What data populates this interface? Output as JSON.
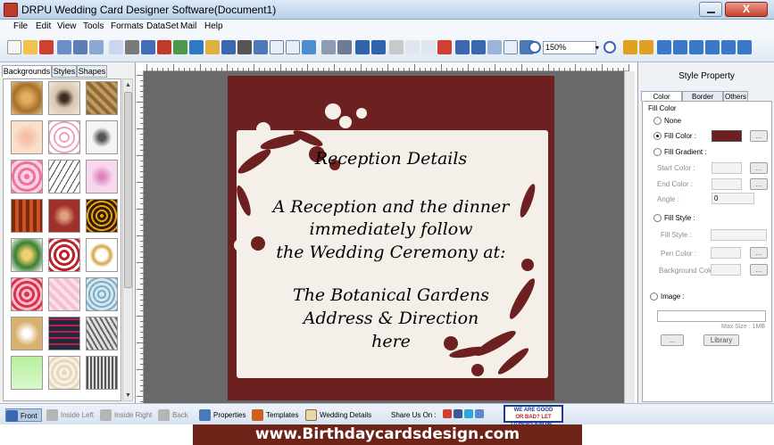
{
  "window": {
    "title": "DRPU Wedding Card Designer Software(Document1)",
    "close_glyph": "X"
  },
  "menu": [
    "File",
    "Edit",
    "View",
    "Tools",
    "Formats",
    "DataSet",
    "Mail",
    "Help"
  ],
  "toolbar": {
    "zoom_value": "150%"
  },
  "left_panel": {
    "tabs": [
      "Backgrounds",
      "Styles",
      "Shapes"
    ],
    "active_tab": "Backgrounds"
  },
  "card": {
    "heading": "Reception Details",
    "line1": "A Reception and the dinner",
    "line2": "immediately follow",
    "line3": "the Wedding Ceremony at:",
    "venue": "The Botanical Gardens",
    "address": "Address & Direction",
    "here": "here",
    "background_color": "#6c2020"
  },
  "style_property": {
    "title": "Style Property",
    "tabs": [
      "Color Effects",
      "Border Effect",
      "Others"
    ],
    "active_tab": "Color Effects",
    "group_label": "Fill Color",
    "none_label": "None",
    "fill_color_label": "Fill Color :",
    "fill_color_value": "#6c2020",
    "fill_gradient_label": "Fill Gradient :",
    "start_color_label": "Start Color :",
    "end_color_label": "End Color :",
    "angle_label": "Angle :",
    "angle_value": "0",
    "fill_style_label": "Fill Style :",
    "fill_style_sub_label": "Fill Style :",
    "pen_color_label": "Pen Color :",
    "background_color_label": "Background Color",
    "image_label": "Image :",
    "max_size_label": "Max Size : 1MB",
    "browse_label": "...",
    "library_label": "Library"
  },
  "bottom_bar": {
    "front": "Front",
    "inside_left": "Inside Left",
    "inside_right": "Inside Right",
    "back": "Back",
    "properties": "Properties",
    "templates": "Templates",
    "wedding_details": "Wedding Details",
    "share_label": "Share Us On :",
    "good_bad_line1": "WE ARE GOOD",
    "good_bad_line2": "OR BAD? LET",
    "good_bad_line3": "OTHERS KNOW..."
  },
  "footer": {
    "url": "www.Birthdaycardsdesign.com"
  }
}
